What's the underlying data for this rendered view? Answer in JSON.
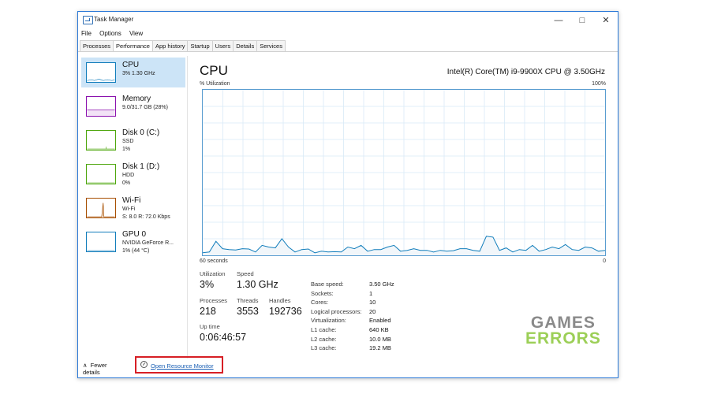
{
  "window": {
    "title": "Task Manager"
  },
  "menu": [
    "File",
    "Options",
    "View"
  ],
  "tabs": [
    "Processes",
    "Performance",
    "App history",
    "Startup",
    "Users",
    "Details",
    "Services"
  ],
  "active_tab": "Performance",
  "sidebar": [
    {
      "name": "CPU",
      "line1": "3% 1.30 GHz",
      "line2": "",
      "selected": true,
      "color": "#117dbb"
    },
    {
      "name": "Memory",
      "line1": "9.0/31.7 GB (28%)",
      "line2": "",
      "selected": false,
      "color": "#8b12ae"
    },
    {
      "name": "Disk 0 (C:)",
      "line1": "SSD",
      "line2": "1%",
      "selected": false,
      "color": "#4da60c"
    },
    {
      "name": "Disk 1 (D:)",
      "line1": "HDD",
      "line2": "0%",
      "selected": false,
      "color": "#4da60c"
    },
    {
      "name": "Wi-Fi",
      "line1": "Wi-Fi",
      "line2": "S: 8.0 R: 72.0 Kbps",
      "selected": false,
      "color": "#a74f01"
    },
    {
      "name": "GPU 0",
      "line1": "NVIDIA GeForce R...",
      "line2": "1% (44 °C)",
      "selected": false,
      "color": "#117dbb"
    }
  ],
  "main": {
    "title": "CPU",
    "model": "Intel(R) Core(TM) i9-9900X CPU @ 3.50GHz",
    "y_label": "% Utilization",
    "y_max": "100%",
    "x_left": "60 seconds",
    "x_right": "0",
    "graph_values": [
      1.5,
      2,
      8.5,
      4,
      3.5,
      3.2,
      4,
      3.8,
      2,
      6,
      5,
      4.5,
      10,
      5,
      2,
      3.5,
      3.8,
      1.5,
      2.5,
      2,
      2.2,
      2,
      5,
      4,
      6,
      2.5,
      3.5,
      3.5,
      5,
      6,
      2.5,
      3,
      4,
      3,
      3,
      2,
      3,
      2.5,
      2.8,
      4,
      4,
      3,
      2.5,
      11.5,
      11,
      3,
      4.5,
      2,
      3.5,
      3,
      6,
      2.5,
      3.5,
      5,
      4,
      6.5,
      3.5,
      3,
      5,
      4.5,
      2.5,
      3
    ],
    "graph_color": "#117dbb",
    "stats": {
      "utilization": {
        "label": "Utilization",
        "value": "3%"
      },
      "speed": {
        "label": "Speed",
        "value": "1.30 GHz"
      },
      "processes": {
        "label": "Processes",
        "value": "218"
      },
      "threads": {
        "label": "Threads",
        "value": "3553"
      },
      "handles": {
        "label": "Handles",
        "value": "192736"
      },
      "uptime": {
        "label": "Up time",
        "value": "0:06:46:57"
      }
    },
    "specs": [
      {
        "k": "Base speed:",
        "v": "3.50 GHz"
      },
      {
        "k": "Sockets:",
        "v": "1"
      },
      {
        "k": "Cores:",
        "v": "10"
      },
      {
        "k": "Logical processors:",
        "v": "20"
      },
      {
        "k": "Virtualization:",
        "v": "Enabled"
      },
      {
        "k": "L1 cache:",
        "v": "640 KB"
      },
      {
        "k": "L2 cache:",
        "v": "10.0 MB"
      },
      {
        "k": "L3 cache:",
        "v": "19.2 MB"
      }
    ]
  },
  "footer": {
    "fewer": "Fewer details",
    "resource_monitor": "Open Resource Monitor"
  },
  "watermark": {
    "line1": "GAMES",
    "line2": "ERRORS"
  }
}
